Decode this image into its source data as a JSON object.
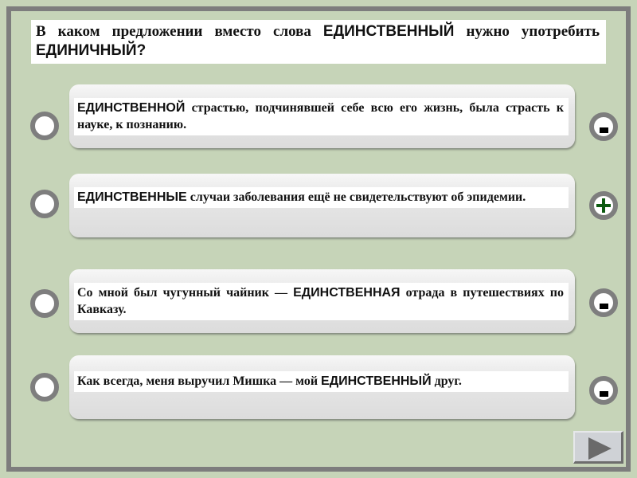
{
  "question": {
    "part1": "В каком предложении вместо слова ",
    "keyword1": "ЕДИНСТВЕННЫЙ",
    "part2": " нужно употребить ",
    "keyword2": "ЕДИНИЧНЫЙ?"
  },
  "options": [
    {
      "keyword": "ЕДИНСТВЕННОЙ",
      "rest": " страстью, подчинявшей себе всю его жизнь, была страсть к науке, к познанию.",
      "result": "minus",
      "result_label": "-"
    },
    {
      "keyword": "ЕДИНСТВЕННЫЕ",
      "rest": " случаи заболевания ещё не свидетельствуют об эпидемии.",
      "result": "plus",
      "result_label": "+"
    },
    {
      "before": "Со мной был чугунный чайник — ",
      "keyword": "ЕДИНСТВЕННАЯ",
      "rest": " отрада в путешествиях по Кавказу.",
      "result": "minus",
      "result_label": "-"
    },
    {
      "before": "Как всегда, меня выручил Мишка — мой ",
      "keyword": "ЕДИНСТВЕННЫЙ",
      "rest": " друг.",
      "result": "minus",
      "result_label": "-"
    }
  ],
  "navigation": {
    "next_icon": "play-triangle-icon"
  },
  "colors": {
    "background": "#c6d4b8",
    "frame": "#7d7d7d",
    "correct": "#0c5a10",
    "wrong": "#000000"
  }
}
